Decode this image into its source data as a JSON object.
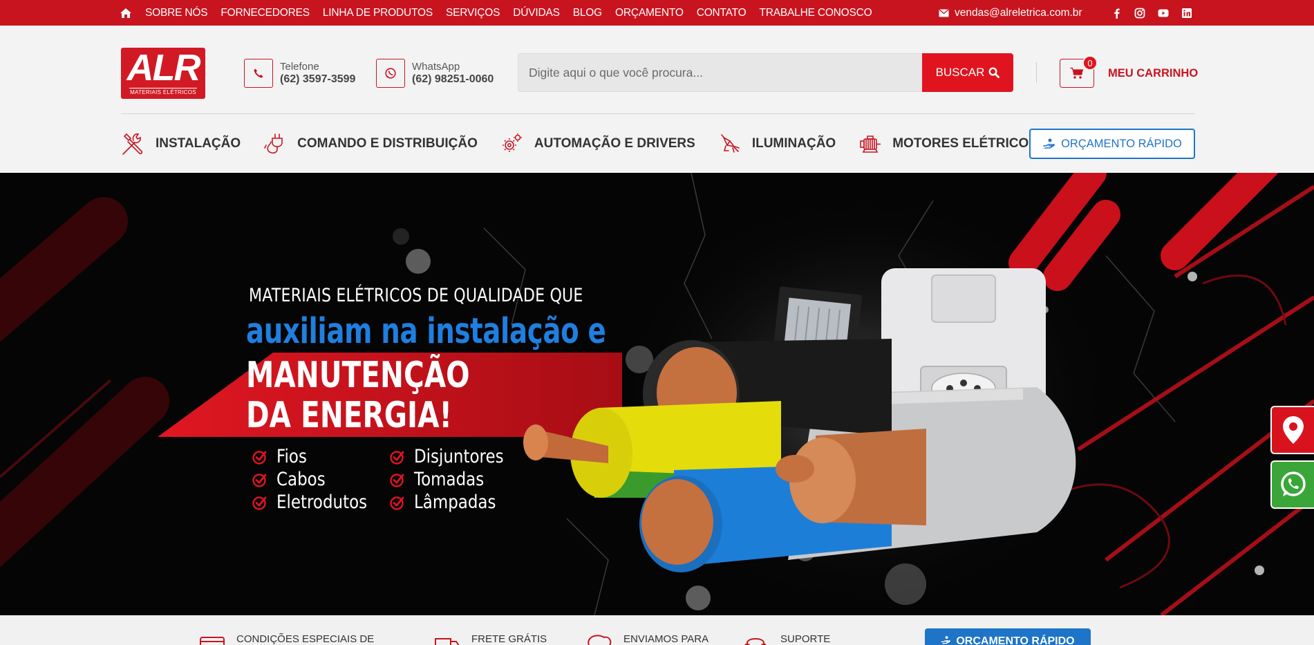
{
  "topbar": {
    "nav": [
      "SOBRE NÓS",
      "FORNECEDORES",
      "LINHA DE PRODUTOS",
      "SERVIÇOS",
      "DÚVIDAS",
      "BLOG",
      "ORÇAMENTO",
      "CONTATO",
      "TRABALHE CONOSCO"
    ],
    "email": "vendas@alreletrica.com.br",
    "socials": [
      "facebook-icon",
      "instagram-icon",
      "youtube-icon",
      "linkedin-icon"
    ],
    "color": "#c8141f"
  },
  "header": {
    "logo_text": "ALR",
    "logo_sub": "MATERIAIS ELÉTRICOS",
    "phone": {
      "label": "Telefone",
      "value": "(62) 3597-3599"
    },
    "whatsapp": {
      "label": "WhatsApp",
      "value": "(62) 98251-0060"
    },
    "search": {
      "placeholder": "Digite aqui o que você procura...",
      "button": "BUSCAR"
    },
    "cart": {
      "count": "0",
      "label": "MEU CARRINHO"
    },
    "categories": [
      {
        "label": "INSTALAÇÃO",
        "icon": "tools-icon"
      },
      {
        "label": "COMANDO E DISTRIBUIÇÃO",
        "icon": "plug-icon"
      },
      {
        "label": "AUTOMAÇÃO E DRIVERS",
        "icon": "gears-icon"
      },
      {
        "label": "ILUMINAÇÃO",
        "icon": "spotlight-icon"
      },
      {
        "label": "MOTORES ELÉTRICOS",
        "icon": "motor-icon"
      }
    ],
    "quick_quote": "ORÇAMENTO RÁPIDO"
  },
  "hero": {
    "line1": "MATERIAIS ELÉTRICOS DE QUALIDADE QUE",
    "line2": "auxiliam na instalação e",
    "line3a": "MANUTENÇÃO",
    "line3b": "DA ENERGIA!",
    "list_left": [
      "Fios",
      "Cabos",
      "Eletrodutos"
    ],
    "list_right": [
      "Disjuntores",
      "Tomadas",
      "Lâmpadas"
    ],
    "accent_blue": "#1f7fe0",
    "accent_red": "#d8131e"
  },
  "features": [
    "CONDIÇÕES ESPECIAIS DE",
    "FRETE GRÁTIS",
    "ENVIAMOS PARA",
    "SUPORTE"
  ],
  "strip_button": "ORÇAMENTO RÁPIDO"
}
